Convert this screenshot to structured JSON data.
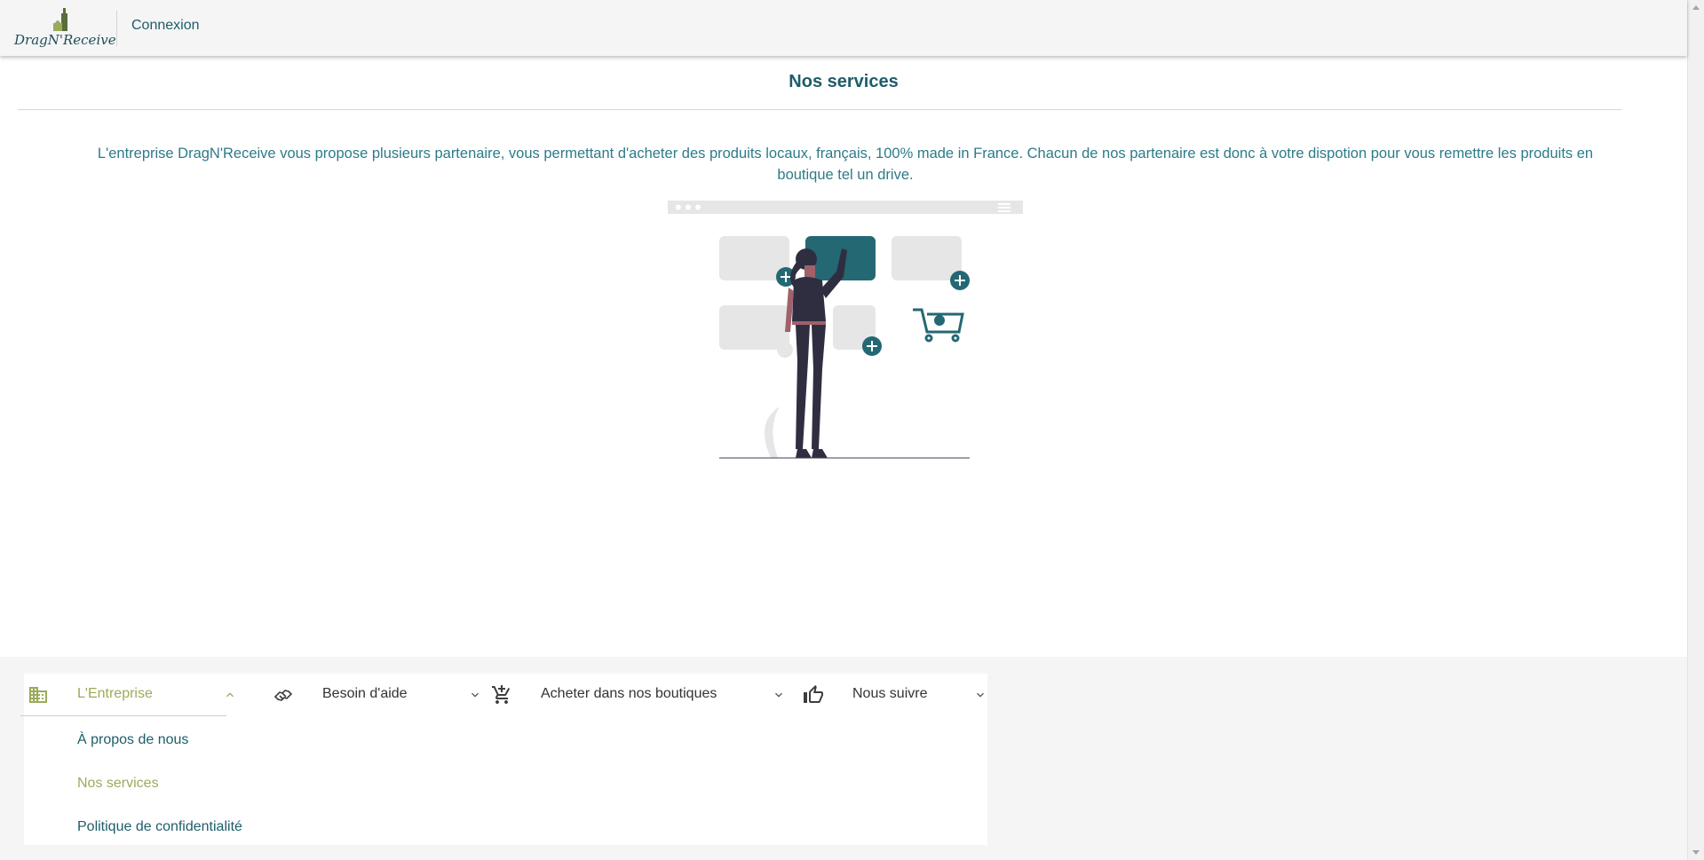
{
  "header": {
    "logo_text": "DragN'Receive",
    "login_link": "Connexion"
  },
  "main": {
    "title": "Nos services",
    "intro": "L'entreprise DragN'Receive vous propose plusieurs partenaire, vous permettant d'acheter des produits locaux, français, 100% made in France. Chacun de nos partenaire est donc à votre dispotion pour vous remettre les produits en boutique tel un drive."
  },
  "footer": {
    "sections": [
      {
        "label": "L'Entreprise",
        "icon": "building-icon",
        "expanded": true
      },
      {
        "label": "Besoin d'aide",
        "icon": "handshake-icon",
        "expanded": false
      },
      {
        "label": "Acheter dans nos boutiques",
        "icon": "cart-add-icon",
        "expanded": false
      },
      {
        "label": "Nous suivre",
        "icon": "thumbs-up-icon",
        "expanded": false
      }
    ],
    "company_links": [
      {
        "label": "À propos de nous",
        "active": false
      },
      {
        "label": "Nos services",
        "active": true
      },
      {
        "label": "Politique de confidentialité",
        "active": false
      }
    ]
  },
  "colors": {
    "primary": "#1d5d6a",
    "accent_green": "#9aab5a",
    "illustration_teal": "#236873",
    "background_grey": "#f5f5f5"
  }
}
